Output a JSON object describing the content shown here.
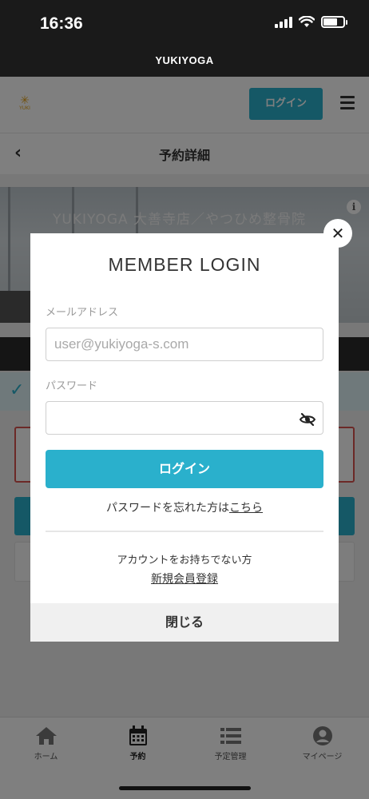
{
  "status_bar": {
    "time": "16:36"
  },
  "app": {
    "title": "YUKIYOGA"
  },
  "header": {
    "logo_text": "YUKI",
    "login_label": "ログイン"
  },
  "subheader": {
    "back_glyph": "‹",
    "title": "予約詳細"
  },
  "hero": {
    "title": "YUKIYOGA 大善寺店／やつひめ整骨院"
  },
  "modal": {
    "title": "MEMBER LOGIN",
    "email_label": "メールアドレス",
    "email_placeholder": "user@yukiyoga-s.com",
    "password_label": "パスワード",
    "login_button": "ログイン",
    "forgot_prefix": "パスワードを忘れた方は",
    "forgot_link": "こちら",
    "no_account_text": "アカウントをお持ちでない方",
    "register_link": "新規会員登録",
    "close_label": "閉じる"
  },
  "tabbar": {
    "items": [
      {
        "label": "ホーム",
        "icon": "home-icon"
      },
      {
        "label": "予約",
        "icon": "calendar-icon"
      },
      {
        "label": "予定管理",
        "icon": "list-icon"
      },
      {
        "label": "マイページ",
        "icon": "user-icon"
      }
    ],
    "active_index": 1
  },
  "colors": {
    "accent": "#2ab0cc",
    "error": "#d9534f"
  }
}
